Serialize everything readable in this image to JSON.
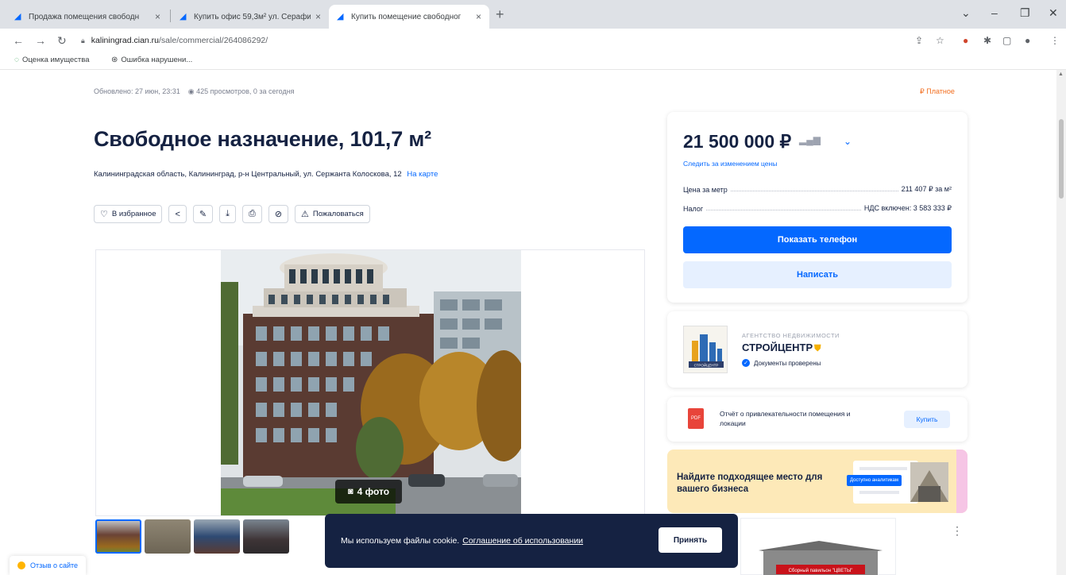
{
  "browser": {
    "tabs": [
      {
        "title": "Продажа помещения свободн",
        "active": false
      },
      {
        "title": "Купить офис 59,3м² ул. Серафи",
        "active": false
      },
      {
        "title": "Купить помещение свободног",
        "active": true
      }
    ],
    "url_host": "kaliningrad.cian.ru",
    "url_path": "/sale/commercial/264086292/",
    "bookmarks": [
      {
        "label": "Оценка имущества",
        "icon": "leaf-icon"
      },
      {
        "label": "Ошибка нарушени...",
        "icon": "globe-icon"
      }
    ]
  },
  "listing": {
    "updated": "Обновлено: 27 июн, 23:31",
    "views": "425 просмотров, 0 за сегодня",
    "paid_label": "Платное",
    "title": "Свободное назначение, 101,7 м²",
    "address": "Калининградская область, Калининград, р-н Центральный, ул. Сержанта Колоскова, 12",
    "map_link": "На карте",
    "actions": {
      "favorite": "В избранное",
      "complain": "Пожаловаться"
    },
    "photo_count": "4 фото"
  },
  "price_card": {
    "price": "21 500 000 ₽",
    "follow_link": "Следить за изменением цены",
    "price_per_meter_label": "Цена за метр",
    "price_per_meter_value": "211 407 ₽ за м²",
    "tax_label": "Налог",
    "tax_value": "НДС включен: 3 583 333 ₽",
    "show_phone": "Показать телефон",
    "write": "Написать"
  },
  "agent": {
    "type": "АГЕНТСТВО НЕДВИЖИМОСТИ",
    "name": "СТРОЙЦЕНТР",
    "verified": "Документы проверены",
    "logo_text": "СТРОЙЦЕНТР"
  },
  "report": {
    "text": "Отчёт о привлекательности помещения и локации",
    "buy": "Купить"
  },
  "promo": {
    "text": "Найдите подходящее место для вашего бизнеса",
    "badge": "Доступно аналитикам"
  },
  "ad": {
    "label": "Сборный павильон \"ЦВЕТЫ\""
  },
  "cookie": {
    "text": "Мы используем файлы cookie.",
    "link": "Соглашение об использовании",
    "accept": "Принять"
  },
  "feedback": "Отзыв о сайте",
  "colors": {
    "brand_blue": "#0468ff",
    "dark": "#152242",
    "paid_orange": "#f26e1f"
  }
}
